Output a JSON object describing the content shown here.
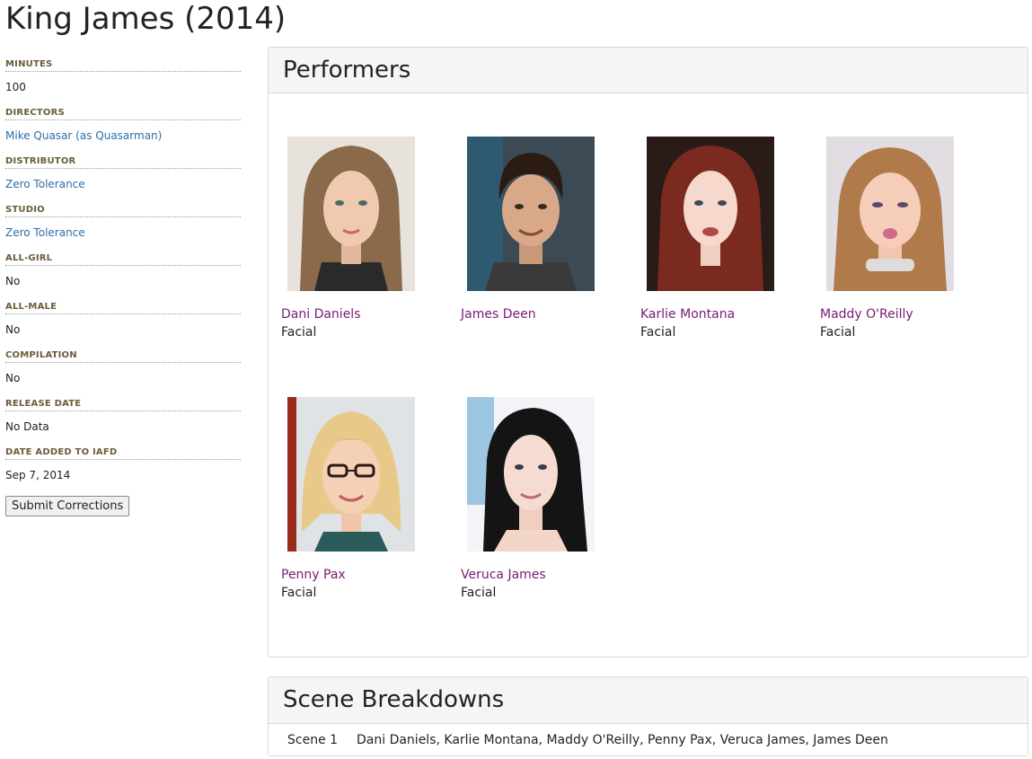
{
  "title": "King James (2014)",
  "sidebar": {
    "fields": [
      {
        "label": "Minutes",
        "value": "100"
      },
      {
        "label": "Directors",
        "value": "Mike Quasar (as Quasarman)"
      },
      {
        "label": "Distributor",
        "value": "Zero Tolerance"
      },
      {
        "label": "Studio",
        "value": "Zero Tolerance"
      },
      {
        "label": "All-Girl",
        "value": "No"
      },
      {
        "label": "All-Male",
        "value": "No"
      },
      {
        "label": "Compilation",
        "value": "No"
      },
      {
        "label": "Release Date",
        "value": "No Data"
      },
      {
        "label": "Date Added to IAFD",
        "value": "Sep 7, 2014"
      }
    ],
    "submit_label": "Submit Corrections"
  },
  "performers": {
    "heading": "Performers",
    "items": [
      {
        "name": "Dani Daniels",
        "role": "Facial"
      },
      {
        "name": "James Deen",
        "role": ""
      },
      {
        "name": "Karlie Montana",
        "role": "Facial"
      },
      {
        "name": "Maddy O'Reilly",
        "role": "Facial"
      },
      {
        "name": "Penny Pax",
        "role": "Facial"
      },
      {
        "name": "Veruca James",
        "role": "Facial"
      }
    ]
  },
  "scenes": {
    "heading": "Scene Breakdowns",
    "rows": [
      {
        "scene": "Scene 1",
        "cast": "Dani Daniels, Karlie Montana, Maddy O'Reilly, Penny Pax, Veruca James, James Deen"
      }
    ]
  },
  "colors": {
    "link": "#2a6fa8",
    "performer_link": "#7a1a72",
    "label": "#6b5c3a",
    "panel_heading_bg": "#f5f5f5"
  }
}
